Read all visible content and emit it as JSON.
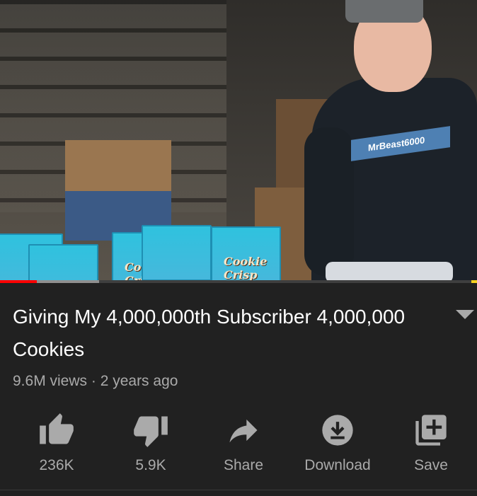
{
  "video": {
    "shirt_text": "MrBeast6000",
    "cereal_brand": "Cookie Crisp",
    "progress": 0.077,
    "buffered": 0.208,
    "colors": {
      "progress": "#ff0000",
      "buffer": "#8f8f8f",
      "marker": "#f7d21f"
    }
  },
  "title": "Giving My 4,000,000th Subscriber 4,000,000 Cookies",
  "meta": "9.6M views · 2 years ago",
  "actions": [
    {
      "icon": "thumbs-up-icon",
      "label": "236K"
    },
    {
      "icon": "thumbs-down-icon",
      "label": "5.9K"
    },
    {
      "icon": "share-icon",
      "label": "Share"
    },
    {
      "icon": "download-icon",
      "label": "Download"
    },
    {
      "icon": "save-playlist-icon",
      "label": "Save"
    }
  ],
  "theme": {
    "background": "#212121",
    "text": "#ffffff",
    "secondary": "#aaaaaa"
  }
}
